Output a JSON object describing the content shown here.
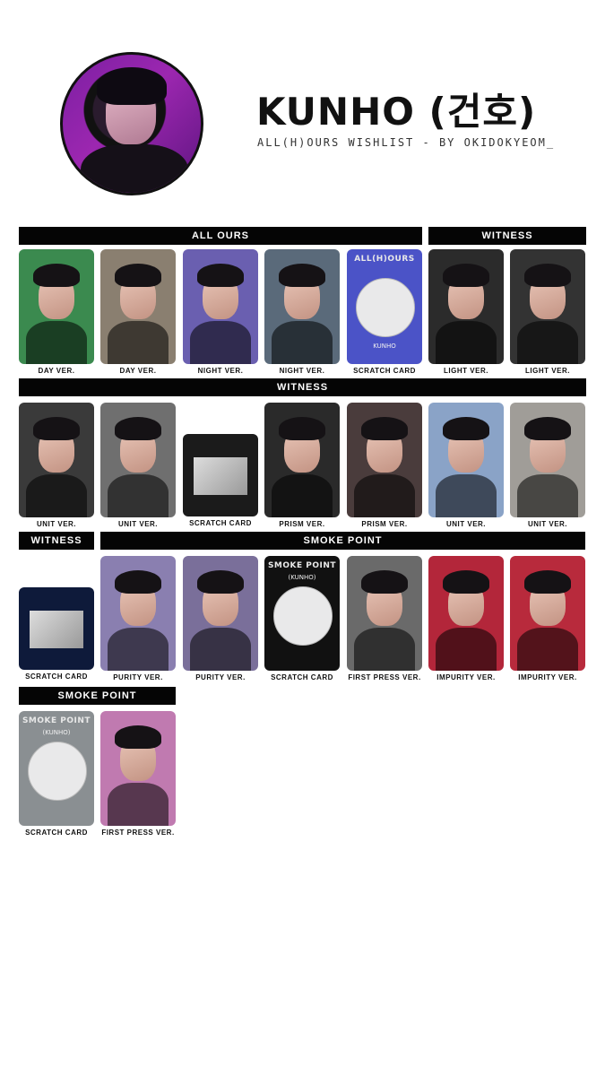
{
  "header": {
    "title": "KUNHO (건호)",
    "subtitle": "ALL(H)OURS WISHLIST - BY OKIDOKYEOM_"
  },
  "sections": [
    {
      "label": "ALL OURS"
    },
    {
      "label": "WITNESS"
    },
    {
      "label": "WITNESS"
    },
    {
      "label": "WITNESS"
    },
    {
      "label": "SMOKE POINT"
    },
    {
      "label": "SMOKE POINT"
    }
  ],
  "cards": [
    {
      "caption": "DAY VER.",
      "bg": "#3b8a4f"
    },
    {
      "caption": "DAY VER.",
      "bg": "#8a7f70"
    },
    {
      "caption": "NIGHT VER.",
      "bg": "#6a5fb0"
    },
    {
      "caption": "NIGHT VER.",
      "bg": "#5a6a7a"
    },
    {
      "caption": "SCRATCH CARD",
      "bg": "#4b53c7",
      "text": "ALL(H)OURS",
      "name": "KUNHO"
    },
    {
      "caption": "LIGHT VER.",
      "bg": "#2b2b2b"
    },
    {
      "caption": "LIGHT VER.",
      "bg": "#333"
    },
    {
      "caption": "UNIT VER.",
      "bg": "#3a3a3a"
    },
    {
      "caption": "UNIT VER.",
      "bg": "#6f6f6f"
    },
    {
      "caption": "SCRATCH CARD",
      "bg": "#1b1b1b"
    },
    {
      "caption": "PRISM VER.",
      "bg": "#2a2a2a"
    },
    {
      "caption": "PRISM VER.",
      "bg": "#4a3c3c"
    },
    {
      "caption": "UNIT VER.",
      "bg": "#8aa3c7"
    },
    {
      "caption": "UNIT VER.",
      "bg": "#a09d98"
    },
    {
      "caption": "SCRATCH CARD",
      "bg": "#0e1a3a"
    },
    {
      "caption": "PURITY VER.",
      "bg": "#8a7fb0"
    },
    {
      "caption": "PURITY VER.",
      "bg": "#7a6f9a"
    },
    {
      "caption": "SCRATCH CARD",
      "bg": "#111",
      "text": "SMOKE POINT",
      "name": "(KUNHO)"
    },
    {
      "caption": "FIRST PRESS VER.",
      "bg": "#6a6a6a"
    },
    {
      "caption": "IMPURITY VER.",
      "bg": "#b3263a"
    },
    {
      "caption": "IMPURITY VER.",
      "bg": "#b82a3c"
    },
    {
      "caption": "SCRATCH CARD",
      "bg": "#8a8f92",
      "text": "SMOKE POINT",
      "name": "(KUNHO)"
    },
    {
      "caption": "FIRST PRESS VER.",
      "bg": "#c07ab0"
    }
  ],
  "colors": {
    "header_bg": "#050505",
    "header_text": "#ffffff"
  }
}
